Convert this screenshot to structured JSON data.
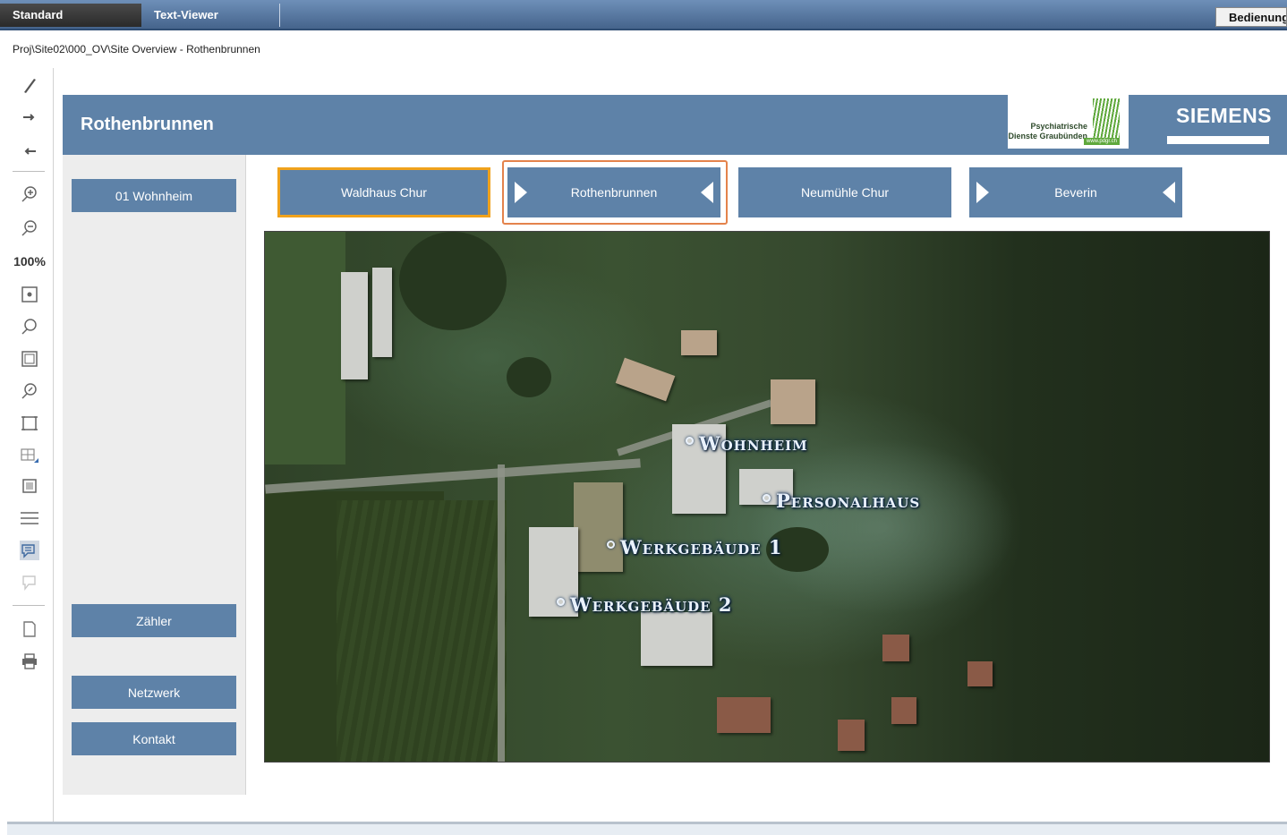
{
  "tabs": [
    {
      "label": "Standard"
    },
    {
      "label": "Text-Viewer"
    }
  ],
  "operate_label": "Bedienung",
  "breadcrumb": "Proj\\Site02\\000_OV\\Site Overview  -  Rothenbrunnen",
  "toolbar": {
    "zoom_level": "100%",
    "icons": [
      "pen-icon",
      "forward-arrow-icon",
      "back-arrow-icon",
      "zoom-in-icon",
      "zoom-out-icon",
      "fit-center-icon",
      "magnifier-icon",
      "window-icon",
      "zoom-area-icon",
      "frame-icon",
      "grid-select-icon",
      "bounds-icon",
      "menu-lines-icon",
      "comment-icon",
      "comment-disabled-icon",
      "page-icon",
      "print-icon"
    ]
  },
  "header": {
    "title": "Rothenbrunnen",
    "partner_logo": {
      "line1": "Psychiatrische",
      "line2": "Dienste Graubünden",
      "url": "www.pdgr.ch"
    },
    "brand": "SIEMENS"
  },
  "sidebar": {
    "top_button": "01 Wohnheim",
    "bottom_buttons": [
      "Zähler",
      "Netzwerk",
      "Kontakt"
    ]
  },
  "sites": [
    {
      "label": "Waldhaus Chur",
      "state": "highlighted"
    },
    {
      "label": "Rothenbrunnen",
      "state": "selected"
    },
    {
      "label": "Neumühle Chur",
      "state": "normal"
    },
    {
      "label": "Beverin",
      "state": "normal"
    }
  ],
  "map_labels": [
    {
      "text": "Wohnheim"
    },
    {
      "text": "Personalhaus"
    },
    {
      "text": "Werkgebäude 1"
    },
    {
      "text": "Werkgebäude 2"
    }
  ],
  "colors": {
    "panel_blue": "#5e82a8",
    "highlight_orange": "#f0a21c",
    "selected_frame": "#e4834c"
  }
}
